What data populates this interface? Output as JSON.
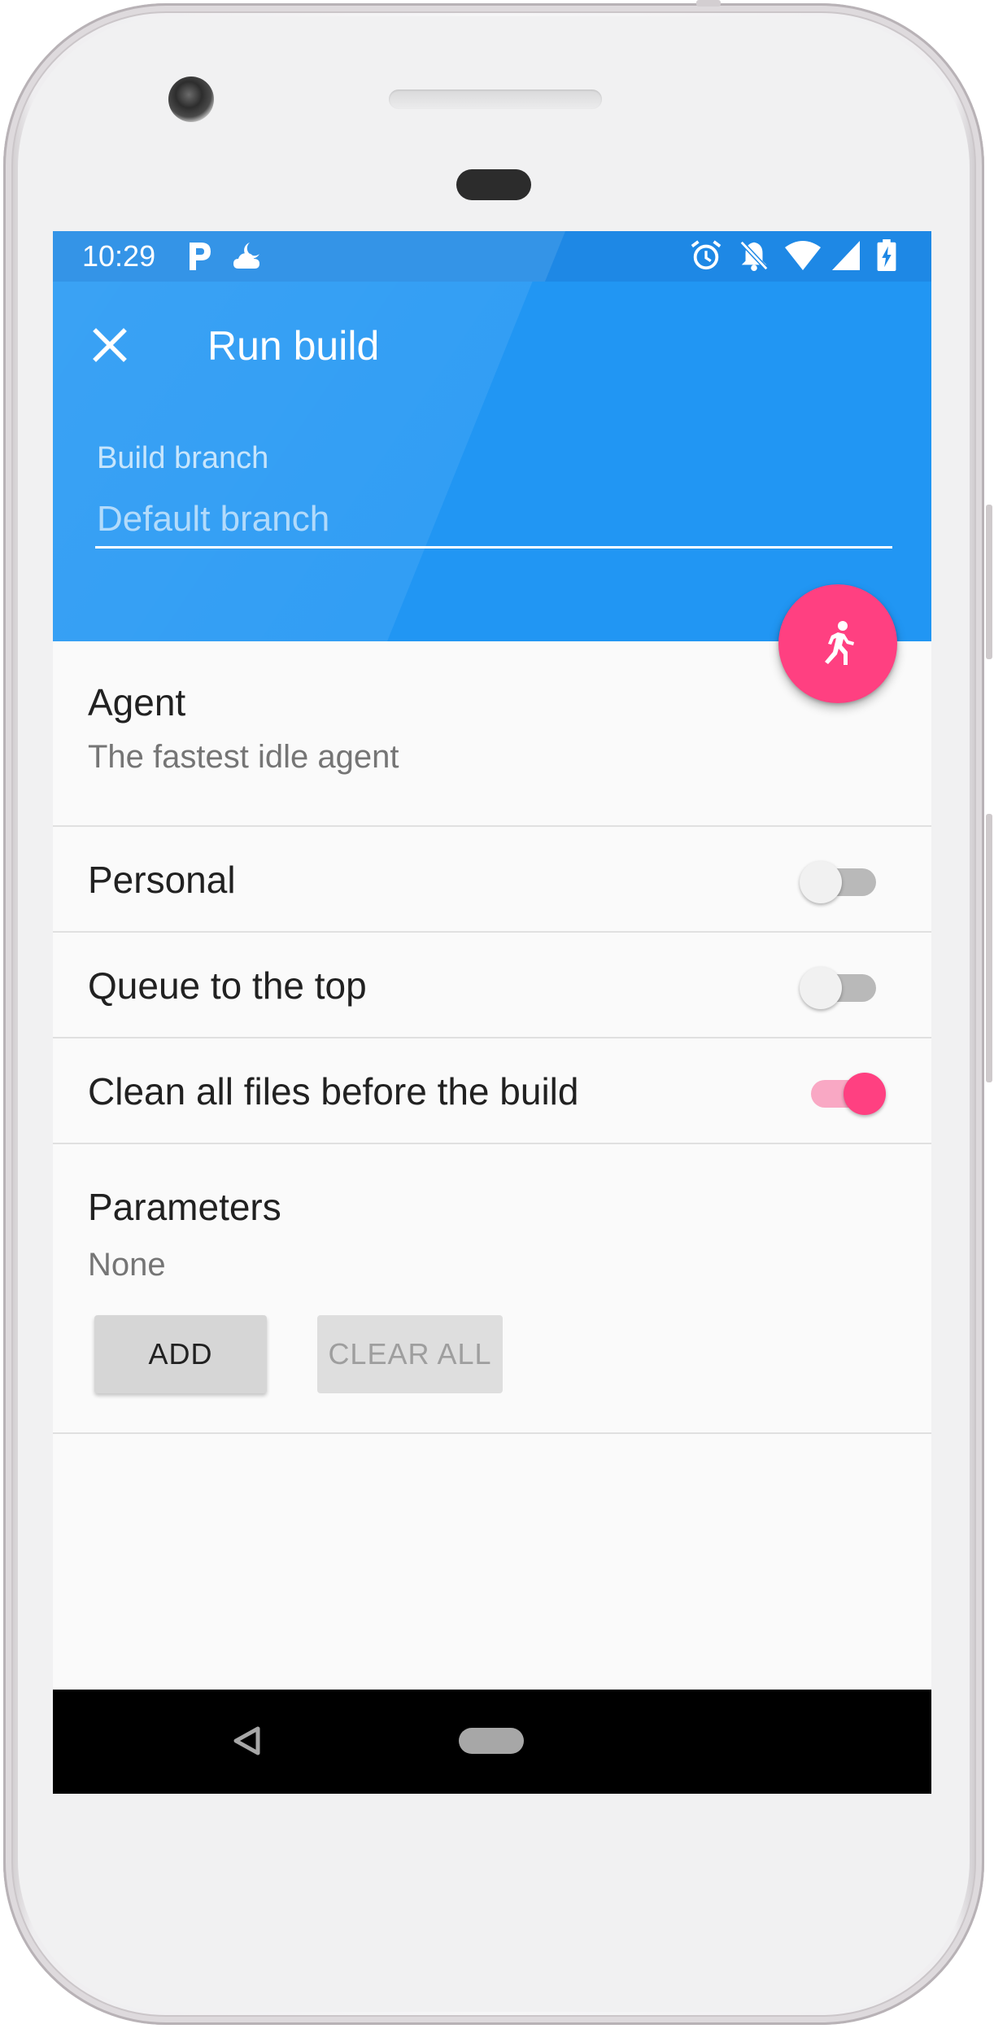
{
  "status_bar": {
    "time": "10:29",
    "left_icons": [
      "parking-p-icon",
      "weather-cloudy-moon-icon"
    ],
    "right_icons": [
      "alarm-icon",
      "notifications-off-icon",
      "wifi-icon",
      "signal-icon",
      "battery-charging-icon"
    ]
  },
  "toolbar": {
    "close_icon": "close-icon",
    "title": "Run build",
    "color": "#2196f3",
    "status_color": "#1e88e5"
  },
  "branch": {
    "label": "Build branch",
    "placeholder": "Default branch",
    "value": ""
  },
  "fab": {
    "icon": "run-person-icon",
    "color": "#ff4081"
  },
  "agent": {
    "title": "Agent",
    "value": "The fastest idle agent"
  },
  "options": [
    {
      "label": "Personal",
      "enabled": false
    },
    {
      "label": "Queue to the top",
      "enabled": false
    },
    {
      "label": "Clean all files before the build",
      "enabled": true
    }
  ],
  "parameters": {
    "title": "Parameters",
    "value": "None",
    "add_label": "ADD",
    "clear_label": "CLEAR ALL"
  },
  "nav": {
    "back_icon": "back-triangle-icon",
    "home_icon": "home-pill-icon"
  }
}
